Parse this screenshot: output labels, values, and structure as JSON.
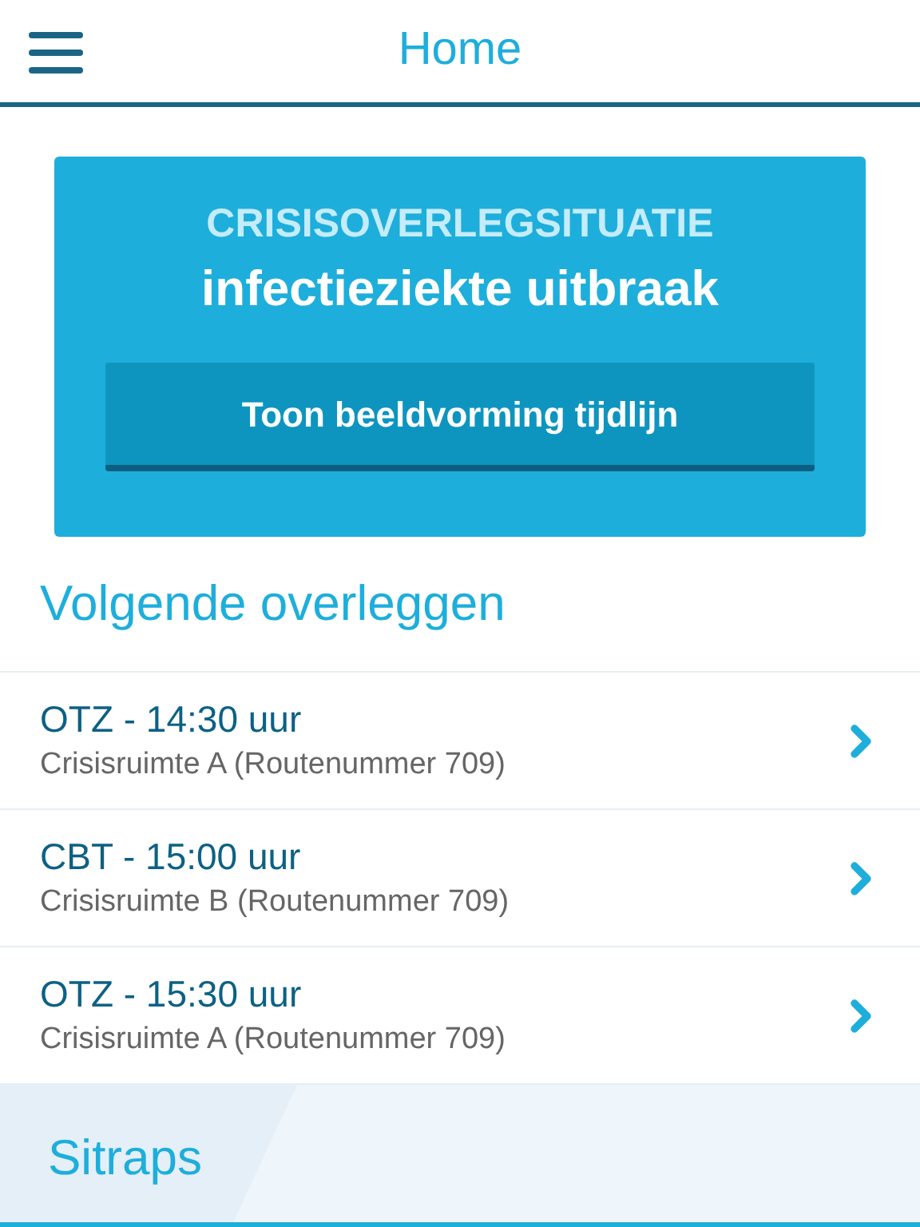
{
  "header": {
    "title": "Home"
  },
  "crisis": {
    "label": "CRISISOVERLEGSITUATIE",
    "title": "infectieziekte uitbraak",
    "button": "Toon beeldvorming tijdlijn"
  },
  "meetings": {
    "heading": "Volgende overleggen",
    "items": [
      {
        "title": "OTZ - 14:30 uur",
        "location": "Crisisruimte A (Routenummer 709)"
      },
      {
        "title": "CBT - 15:00 uur",
        "location": "Crisisruimte B (Routenummer 709)"
      },
      {
        "title": "OTZ - 15:30 uur",
        "location": "Crisisruimte A (Routenummer 709)"
      }
    ]
  },
  "sitraps": {
    "heading": "Sitraps"
  }
}
